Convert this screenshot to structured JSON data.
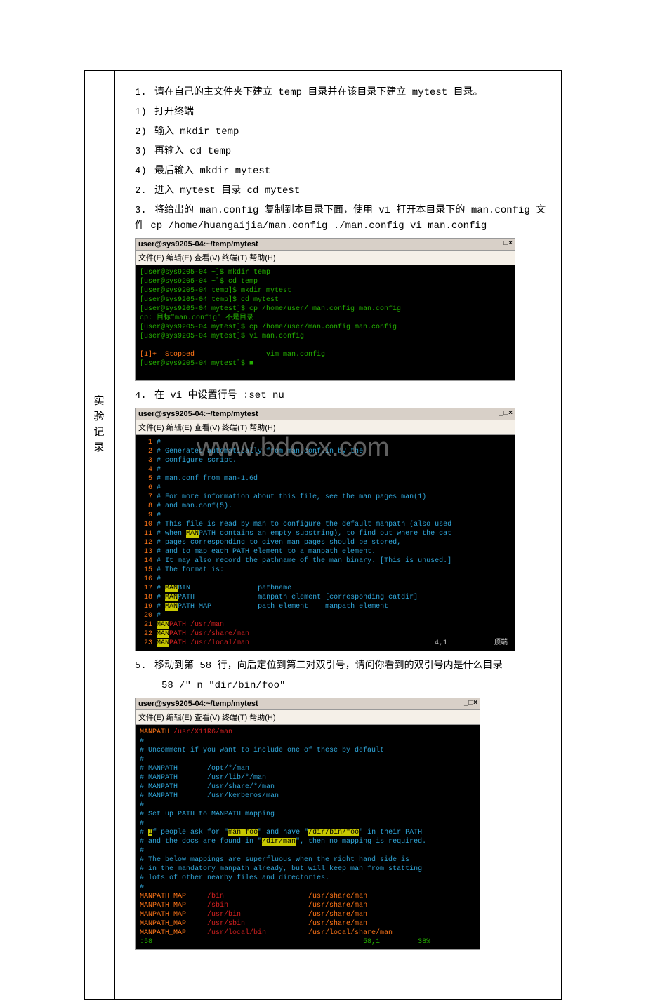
{
  "sidebar": {
    "c1": "实",
    "c2": "验",
    "c3": "记",
    "c4": "录"
  },
  "steps": {
    "s1": "请在自己的主文件夹下建立 temp 目录并在该目录下建立 mytest 目录。",
    "s1a": "打开终端",
    "s1b": "输入 mkdir temp",
    "s1c": "再输入 cd temp",
    "s1d": "最后输入 mkdir mytest",
    "s2": "进入 mytest 目录    cd mytest",
    "s3": "将给出的 man.config 复制到本目录下面，使用 vi 打开本目录下的 man.config 文件     cp /home/huangaijia/man.config ./man.config  vi man.config",
    "s4": "在 vi 中设置行号   :set nu",
    "s5": "移动到第 58 行，向后定位到第二对双引号，请问你看到的双引号内是什么目录",
    "s5b": "58 /\"    n    \"dir/bin/foo\""
  },
  "watermark": "www.bdocx.com",
  "term1": {
    "title": "user@sys9205-04:~/temp/mytest",
    "menu": "文件(E)   编辑(E)   查看(V)   终端(T)   帮助(H)",
    "winbtns": "_ □ ×",
    "lines": {
      "l1": "[user@sys9205-04 ~]$ mkdir temp",
      "l2": "[user@sys9205-04 ~]$ cd temp",
      "l3": "[user@sys9205-04 temp]$ mkdir mytest",
      "l4": "[user@sys9205-04 temp]$ cd mytest",
      "l5": "[user@sys9205-04 mytest]$ cp /home/user/ man.config man.config",
      "l6": "cp: 目标\"man.config\" 不是目录",
      "l7": "[user@sys9205-04 mytest]$ cp /home/user/man.config man.config",
      "l8": "[user@sys9205-04 mytest]$ vi man.config",
      "l9": "",
      "l10a": "[1]+  Stopped",
      "l10b": "                 vim man.config",
      "l11": "[user@sys9205-04 mytest]$ ■"
    }
  },
  "term2": {
    "title": "user@sys9205-04:~/temp/mytest",
    "menu": "文件(E)   编辑(E)   查看(V)   终端(T)   帮助(H)",
    "winbtns": "_ □ ×",
    "lines": {
      "n1": "  1 ",
      "n2": "  2 ",
      "n3": "  3 ",
      "n4": "  4 ",
      "n5": "  5 ",
      "n6": "  6 ",
      "n7": "  7 ",
      "n8": "  8 ",
      "n9": "  9 ",
      "n10": " 10 ",
      "n11": " 11 ",
      "n12": " 12 ",
      "n13": " 13 ",
      "n14": " 14 ",
      "n15": " 15 ",
      "n16": " 16 ",
      "n17": " 17 ",
      "n18": " 18 ",
      "n19": " 19 ",
      "n20": " 20 ",
      "n21": " 21 ",
      "n22": " 22 ",
      "n23": " 23 ",
      "t1": "#",
      "t2": "# Generated automatically from man.conf.in by the",
      "t3": "# configure script.",
      "t4": "#",
      "t5": "# man.conf from man-1.6d",
      "t6": "#",
      "t7": "# For more information about this file, see the man pages man(1)",
      "t8": "# and man.conf(5).",
      "t9": "#",
      "t10": "# This file is read by man to configure the default manpath (also used",
      "t11a": "# when ",
      "t11b": "MAN",
      "t11c": "PATH contains an empty substring), to find out where the cat",
      "t12": "# pages corresponding to given man pages should be stored,",
      "t13": "# and to map each PATH element to a manpath element.",
      "t14": "# It may also record the pathname of the man binary. [This is unused.]",
      "t15": "# The format is:",
      "t16": "#",
      "t17a": "# ",
      "t17b": "MAN",
      "t17c": "BIN                pathname",
      "t18a": "# ",
      "t18b": "MAN",
      "t18c": "PATH               manpath_element [corresponding_catdir]",
      "t19a": "# ",
      "t19b": "MAN",
      "t19c": "PATH_MAP           path_element    manpath_element",
      "t20": "#",
      "t21a": "MAN",
      "t21b": "PATH /usr/man",
      "t22a": "MAN",
      "t22b": "PATH /usr/share/man",
      "t23a": "MAN",
      "t23b": "PATH /usr/local/man",
      "status": "4,1           顶端"
    }
  },
  "term3": {
    "title": "user@sys9205-04:~/temp/mytest",
    "menu": "文件(E)   编辑(E)   查看(V)   终端(T)   帮助(H)",
    "winbtns": "_ □ ×",
    "lines": {
      "l1a": "MANPATH ",
      "l1b": "/usr/X11R6/man",
      "l2": "#",
      "l3": "# Uncomment if you want to include one of these by default",
      "l4": "#",
      "l5": "# MANPATH       /opt/*/man",
      "l6": "# MANPATH       /usr/lib/*/man",
      "l7": "# MANPATH       /usr/share/*/man",
      "l8": "# MANPATH       /usr/kerberos/man",
      "l9": "#",
      "l10": "# Set up PATH to MANPATH mapping",
      "l11": "#",
      "l12a": "# ",
      "l12b": "I",
      "l12c": "f people ask for \"",
      "l12d": "man foo",
      "l12e": "\" and have \"",
      "l12f": "/dir/bin/foo",
      "l12g": "\" in their PATH",
      "l13a": "# and the docs are found in \"",
      "l13b": "/dir/man",
      "l13c": "\", then no mapping is required.",
      "l14": "#",
      "l15": "# The below mappings are superfluous when the right hand side is",
      "l16": "# in the mandatory manpath already, but will keep man from statting",
      "l17": "# lots of other nearby files and directories.",
      "l18": "#",
      "l19a": "MANPATH_MAP     ",
      "l19b": "/bin",
      "l19c": "                    /usr/share/man",
      "l20a": "MANPATH_MAP     ",
      "l20b": "/sbin",
      "l20c": "                   /usr/share/man",
      "l21a": "MANPATH_MAP     ",
      "l21b": "/usr/bin",
      "l21c": "                /usr/share/man",
      "l22a": "MANPATH_MAP     ",
      "l22b": "/usr/sbin",
      "l22c": "               /usr/share/man",
      "l23a": "MANPATH_MAP     ",
      "l23b": "/usr/local/bin",
      "l23c": "          /usr/local/share/man",
      "status": ":58                                                  58,1         38%"
    }
  }
}
